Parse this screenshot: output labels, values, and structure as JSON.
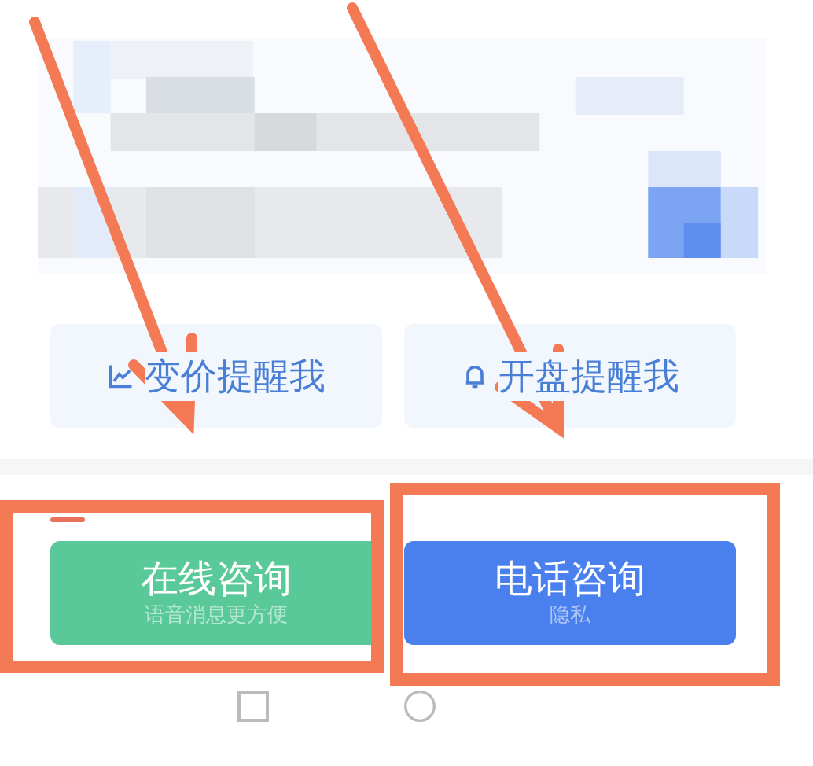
{
  "reminder_buttons": [
    {
      "kind": "chart",
      "label": "变价提醒我"
    },
    {
      "kind": "bell",
      "label": "开盘提醒我"
    }
  ],
  "consult_buttons": [
    {
      "kind": "online",
      "title": "在线咨询",
      "subtitle": "语音消息更方便"
    },
    {
      "kind": "phone",
      "title": "电话咨询",
      "subtitle": "隐私"
    }
  ]
}
